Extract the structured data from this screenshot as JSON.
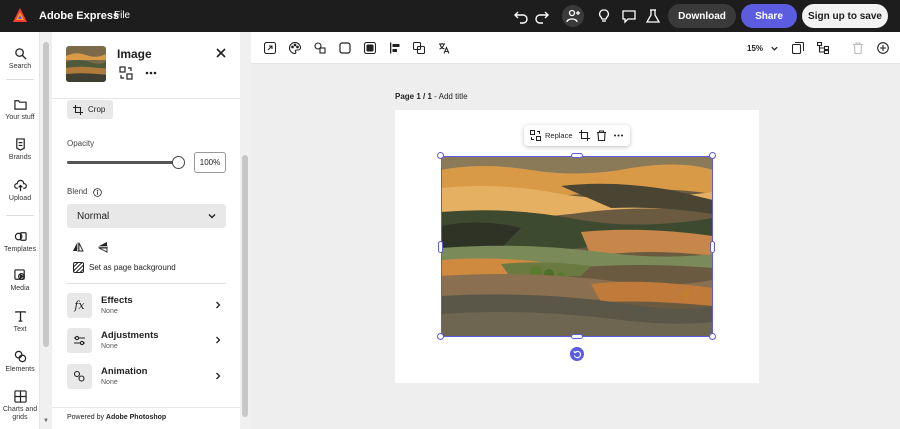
{
  "app": {
    "name": "Adobe Express",
    "file_menu": "File",
    "brand_color": "#5c5ce0"
  },
  "topbar": {
    "download_label": "Download",
    "share_label": "Share",
    "signup_label": "Sign up to save",
    "icons": [
      "undo-icon",
      "redo-icon",
      "add-user-icon",
      "lightbulb-icon",
      "comment-icon",
      "flask-icon"
    ]
  },
  "rail": {
    "items": [
      {
        "label": "Search",
        "icon": "search-icon"
      },
      {
        "label": "Your stuff",
        "icon": "folder-icon"
      },
      {
        "label": "Brands",
        "icon": "brand-icon"
      },
      {
        "label": "Upload",
        "icon": "upload-icon"
      },
      {
        "label": "Templates",
        "icon": "templates-icon"
      },
      {
        "label": "Media",
        "icon": "media-icon"
      },
      {
        "label": "Text",
        "icon": "text-icon"
      },
      {
        "label": "Elements",
        "icon": "elements-icon"
      },
      {
        "label": "Charts and grids",
        "icon": "charts-icon"
      }
    ]
  },
  "panel": {
    "title": "Image",
    "crop_label": "Crop",
    "opacity_label": "Opacity",
    "opacity_value": "100%",
    "opacity_fraction": 1.0,
    "blend_label": "Blend",
    "blend_value": "Normal",
    "set_background_label": "Set as page background",
    "properties": [
      {
        "title": "Effects",
        "subtitle": "None",
        "icon": "fx-icon"
      },
      {
        "title": "Adjustments",
        "subtitle": "None",
        "icon": "sliders-icon"
      },
      {
        "title": "Animation",
        "subtitle": "None",
        "icon": "animation-icon"
      }
    ],
    "powered_prefix": "Powered by",
    "powered_brand": "Adobe Photoshop"
  },
  "canvas": {
    "zoom": "15%",
    "page_label": "Page 1 / 1",
    "add_title": "Add title",
    "replace_label": "Replace"
  }
}
